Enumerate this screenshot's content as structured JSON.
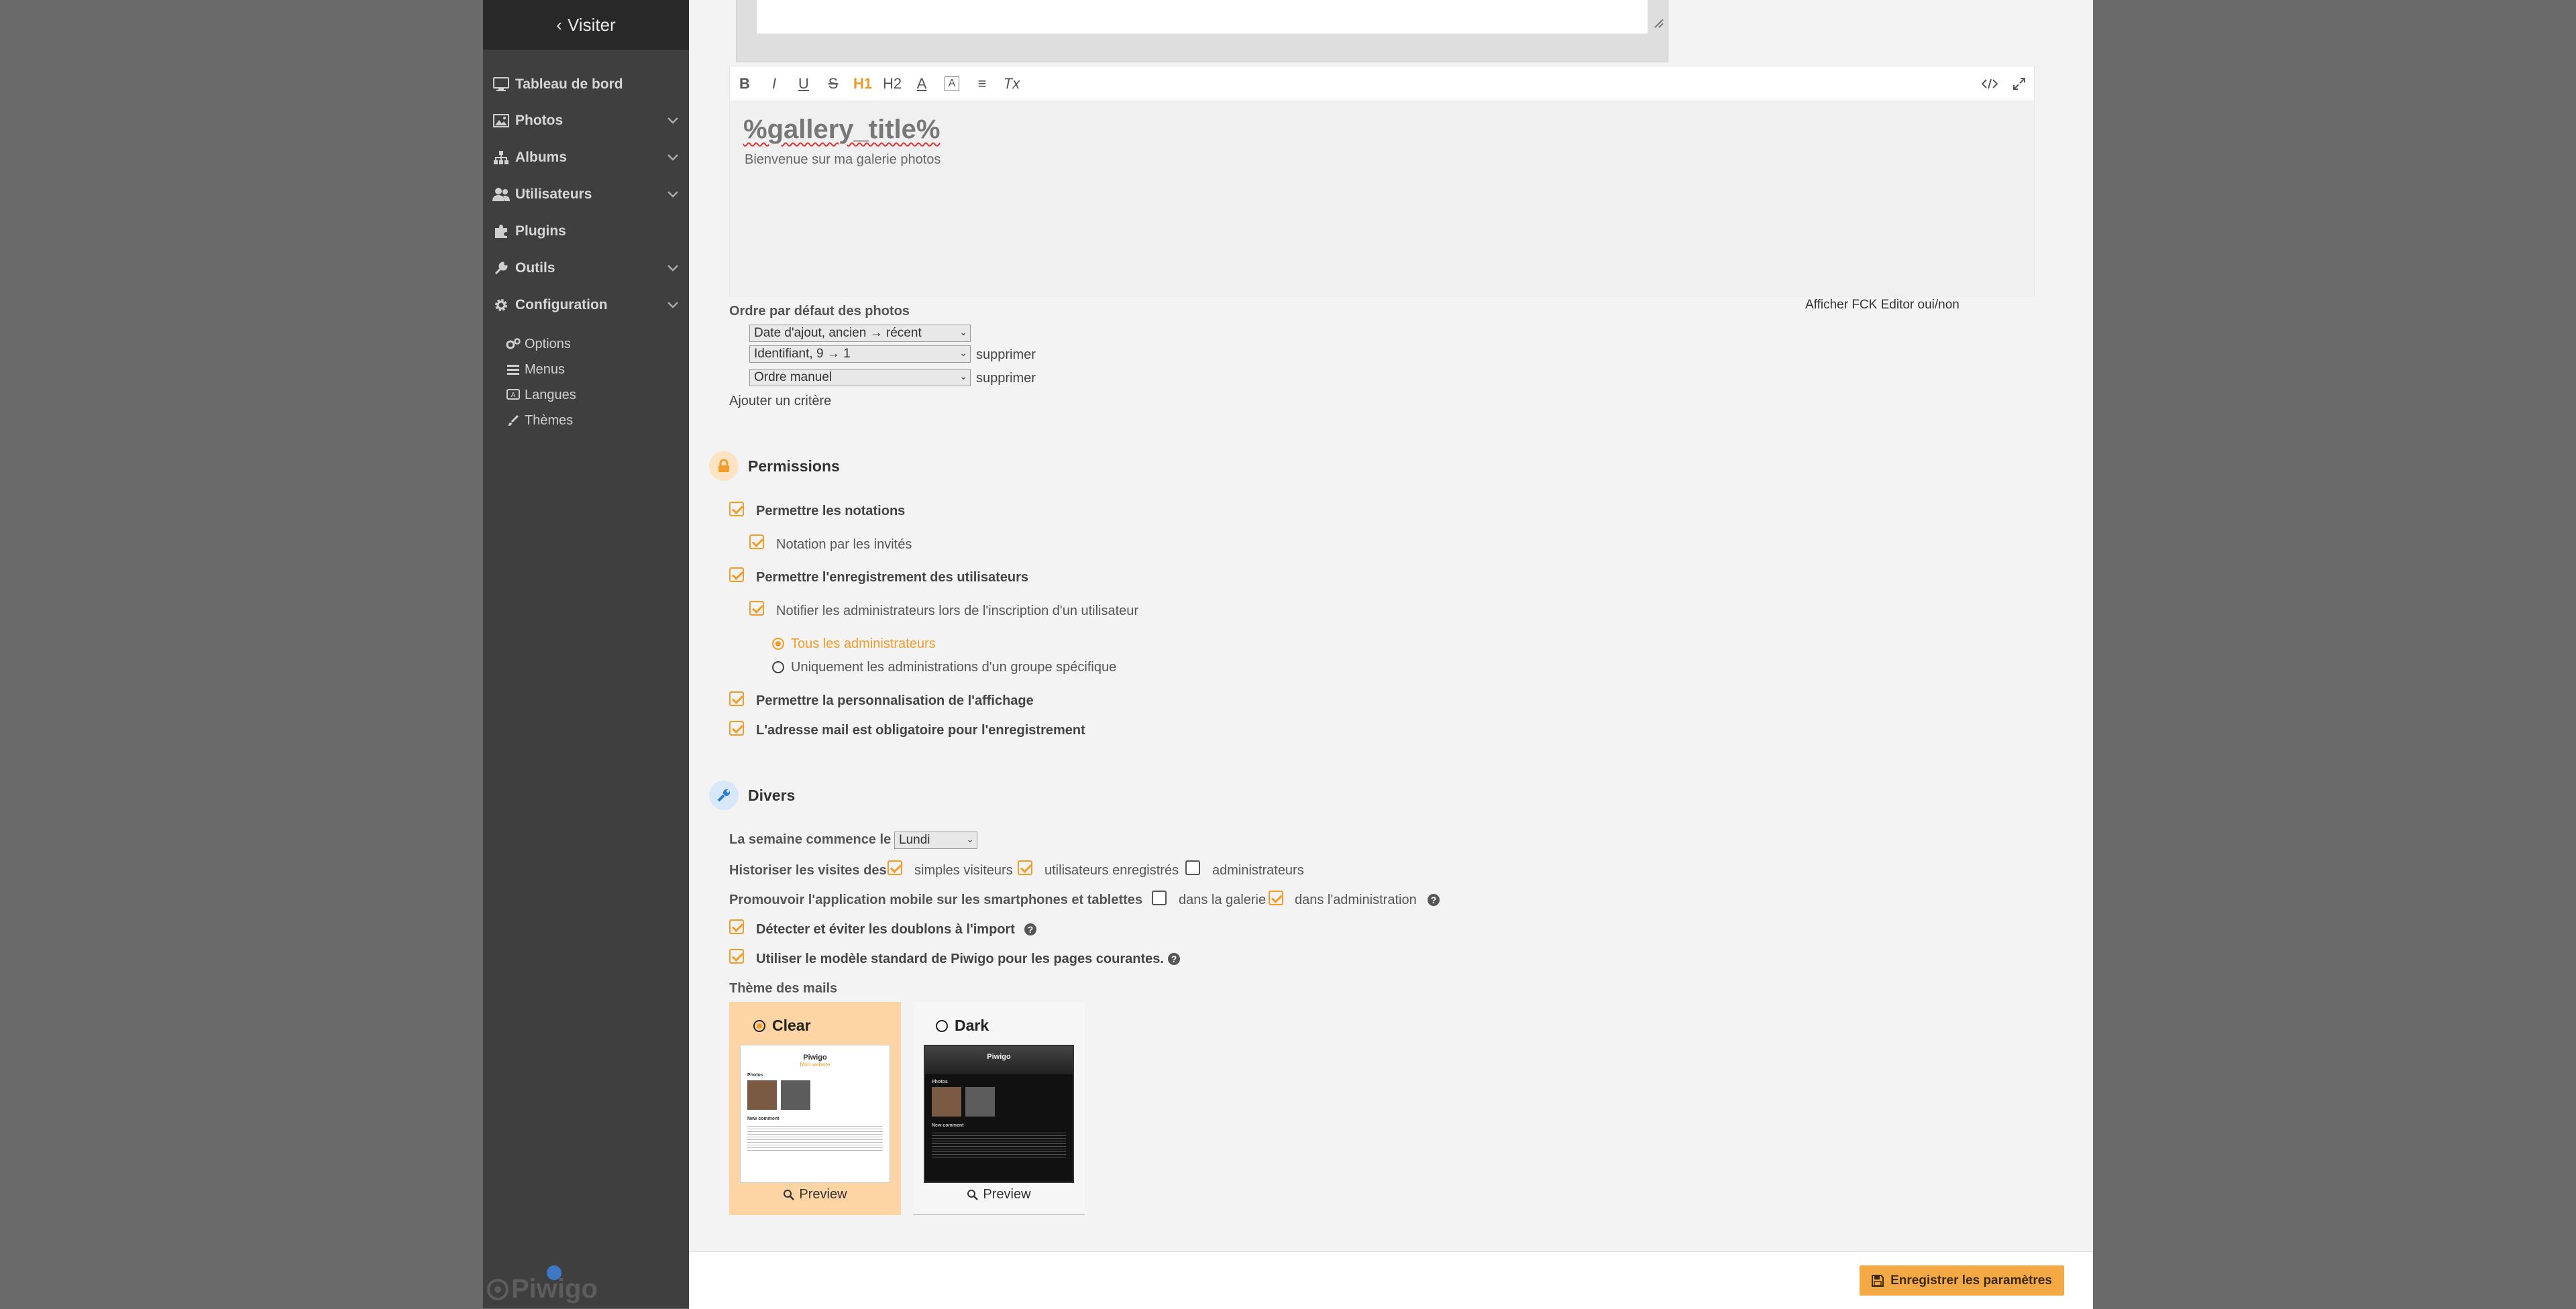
{
  "sidebar": {
    "visit_label": "Visiter",
    "items": [
      {
        "label": "Tableau de bord",
        "icon": "monitor-icon",
        "has_chevron": false
      },
      {
        "label": "Photos",
        "icon": "image-icon",
        "has_chevron": true
      },
      {
        "label": "Albums",
        "icon": "sitemap-icon",
        "has_chevron": true
      },
      {
        "label": "Utilisateurs",
        "icon": "users-icon",
        "has_chevron": true
      },
      {
        "label": "Plugins",
        "icon": "puzzle-icon",
        "has_chevron": false
      },
      {
        "label": "Outils",
        "icon": "wrench-icon",
        "has_chevron": true
      },
      {
        "label": "Configuration",
        "icon": "gear-icon",
        "has_chevron": true
      }
    ],
    "sub_items": [
      {
        "label": "Options",
        "icon": "cogs-icon"
      },
      {
        "label": "Menus",
        "icon": "menu-icon"
      },
      {
        "label": "Langues",
        "icon": "language-icon"
      },
      {
        "label": "Thèmes",
        "icon": "brush-icon"
      }
    ],
    "brand": "Piwigo"
  },
  "editor": {
    "toolbar": [
      "B",
      "I",
      "U",
      "S",
      "H1",
      "H2",
      "A",
      "A",
      "≡",
      "Tx"
    ],
    "title_text": "%gallery_title%",
    "sub_text": "Bienvenue sur ma galerie photos",
    "fck_toggle": "Afficher FCK Editor oui/non"
  },
  "order": {
    "label": "Ordre par défaut des photos",
    "criteria": [
      {
        "value": "Date d'ajout, ancien → récent",
        "remove": ""
      },
      {
        "value": "Identifiant, 9 → 1",
        "remove": "supprimer"
      },
      {
        "value": "Ordre manuel",
        "remove": "supprimer"
      }
    ],
    "add_label": "Ajouter un critère"
  },
  "permissions": {
    "title": "Permissions",
    "allow_rating": "Permettre les notations",
    "guest_rating": "Notation par les invités",
    "allow_registration": "Permettre l'enregistrement des utilisateurs",
    "notify_admins": "Notifier les administrateurs lors de l'inscription d'un utilisateur",
    "all_admins": "Tous les administrateurs",
    "group_admins": "Uniquement les administrations d'un groupe spécifique",
    "allow_custom_display": "Permettre la personnalisation de l'affichage",
    "email_mandatory": "L'adresse mail est obligatoire pour l'enregistrement"
  },
  "misc": {
    "title": "Divers",
    "week_start_label": "La semaine commence le",
    "week_start_value": "Lundi",
    "history_label": "Historiser les visites des",
    "history_guests": "simples visiteurs",
    "history_users": "utilisateurs enregistrés",
    "history_admins": "administrateurs",
    "mobile_label": "Promouvoir l'application mobile sur les smartphones et tablettes",
    "mobile_gallery": "dans la galerie",
    "mobile_admin": "dans l'administration",
    "duplicates": "Détecter et éviter les doublons à l'import",
    "standard_template": "Utiliser le modèle standard de Piwigo pour les pages courantes.",
    "mail_theme_label": "Thème des mails",
    "themes": [
      {
        "name": "Clear",
        "preview": "Preview",
        "selected": true
      },
      {
        "name": "Dark",
        "preview": "Preview",
        "selected": false
      }
    ],
    "thumb_brand": "Piwigo",
    "thumb_sub": "Mon website",
    "thumb_photos": "Photos",
    "thumb_comment": "New comment"
  },
  "save_button": "Enregistrer les paramètres",
  "colors": {
    "accent": "#f29c2a",
    "sidebar_bg": "#3f3f3f",
    "main_bg": "#f3f3f3",
    "save_bg": "#f5a945"
  }
}
